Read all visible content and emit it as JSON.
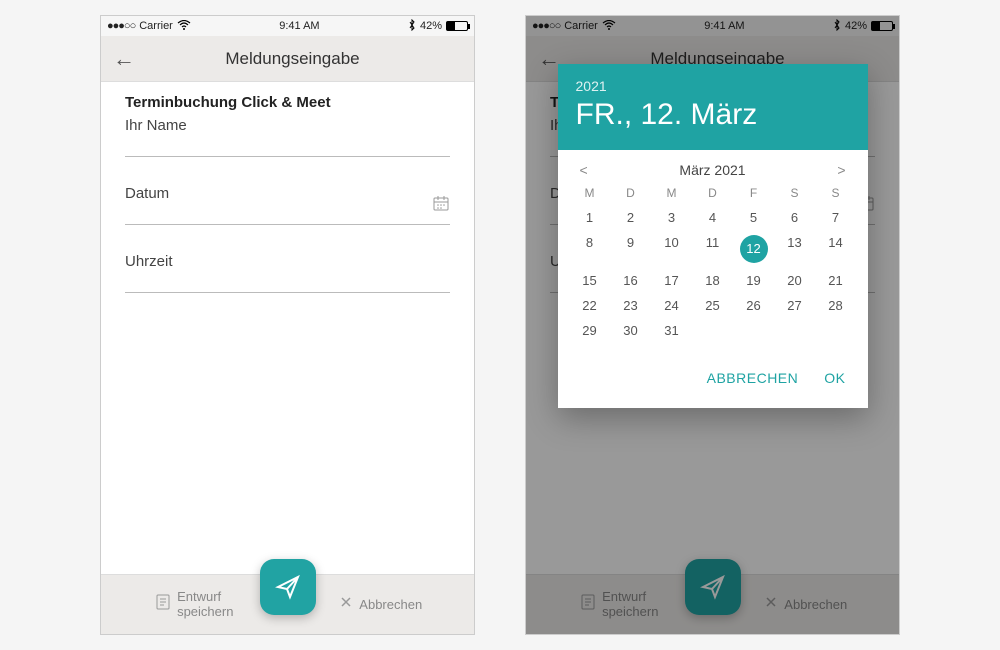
{
  "statusbar": {
    "signal": "●●●○○",
    "carrier": "Carrier",
    "time": "9:41 AM",
    "battery_pct": "42%",
    "battery_level": 42
  },
  "header": {
    "back_icon": "←",
    "title": "Meldungseingabe"
  },
  "form": {
    "section_title": "Terminbuchung Click & Meet",
    "name_label": "Ihr Name",
    "date_label": "Datum",
    "time_label": "Uhrzeit"
  },
  "bottombar": {
    "draft_icon": "📄",
    "draft_label": "Entwurf\nspeichern",
    "cancel_icon": "✕",
    "cancel_label": "Abbrechen"
  },
  "datepicker": {
    "year": "2021",
    "long_date": "FR., 12. März",
    "month_label": "März 2021",
    "prev": "<",
    "next": ">",
    "dow": [
      "M",
      "D",
      "M",
      "D",
      "F",
      "S",
      "S"
    ],
    "weeks": [
      [
        "1",
        "2",
        "3",
        "4",
        "5",
        "6",
        "7"
      ],
      [
        "8",
        "9",
        "10",
        "11",
        "12",
        "13",
        "14"
      ],
      [
        "15",
        "16",
        "17",
        "18",
        "19",
        "20",
        "21"
      ],
      [
        "22",
        "23",
        "24",
        "25",
        "26",
        "27",
        "28"
      ],
      [
        "29",
        "30",
        "31",
        "",
        "",
        "",
        ""
      ]
    ],
    "selected": "12",
    "cancel": "ABBRECHEN",
    "ok": "OK"
  }
}
